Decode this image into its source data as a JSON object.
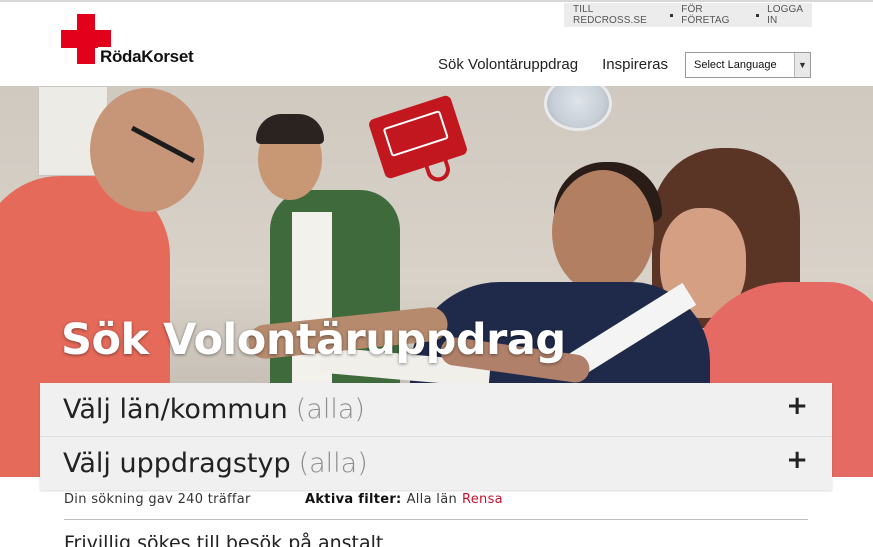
{
  "utility_nav": {
    "items": [
      "TILL REDCROSS.SE",
      "FÖR FÖRETAG",
      "LOGGA IN"
    ]
  },
  "logo": {
    "wordmark": "RödaKorset",
    "brand_color": "#e2001a"
  },
  "main_nav": {
    "items": [
      "Sök Volontäruppdrag",
      "Inspireras"
    ]
  },
  "language_select": {
    "selected": "Select Language"
  },
  "hero": {
    "title": "Sök Volontäruppdrag"
  },
  "filters": [
    {
      "label": "Välj län/kommun",
      "value": "(alla)",
      "icon": "plus-icon"
    },
    {
      "label": "Välj uppdragstyp",
      "value": "(alla)",
      "icon": "plus-icon"
    }
  ],
  "results": {
    "count_text": "Din sökning gav 240 träffar",
    "active_filters_label": "Aktiva filter:",
    "active_filters_value": "Alla län",
    "reset_label": "Rensa",
    "reset_color": "#c8102e"
  },
  "result_list": {
    "first_title": "Frivillig sökes till besök på anstalt"
  }
}
